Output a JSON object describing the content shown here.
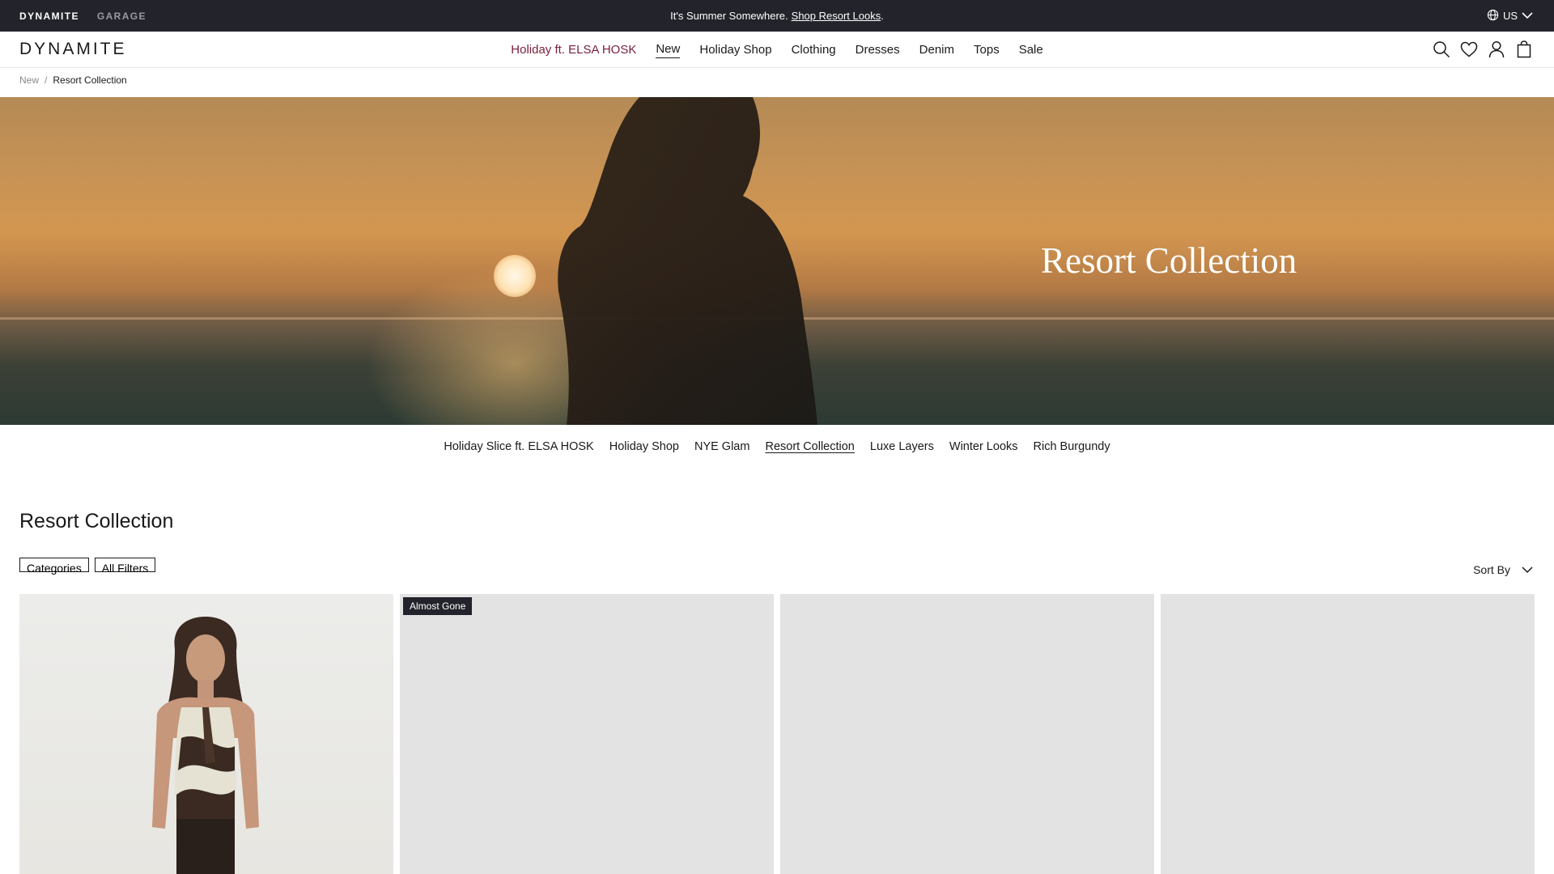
{
  "topbar": {
    "brands": [
      "DYNAMITE",
      "GARAGE"
    ],
    "promo_text": "It's Summer Somewhere.",
    "promo_link": "Shop Resort Looks",
    "promo_end": ".",
    "region": "US"
  },
  "header": {
    "logo": "DYNAMITE",
    "nav": [
      "Holiday ft. ELSA HOSK",
      "New",
      "Holiday Shop",
      "Clothing",
      "Dresses",
      "Denim",
      "Tops",
      "Sale"
    ],
    "icons": [
      "search-icon",
      "heart-icon",
      "account-icon",
      "bag-icon"
    ]
  },
  "breadcrumb": {
    "parent": "New",
    "separator": "/",
    "current": "Resort Collection"
  },
  "hero": {
    "title": "Resort Collection"
  },
  "subnav": [
    "Holiday Slice ft. ELSA HOSK",
    "Holiday Shop",
    "NYE Glam",
    "Resort Collection",
    "Luxe Layers",
    "Winter Looks",
    "Rich Burgundy"
  ],
  "listing": {
    "title": "Resort Collection",
    "filters": [
      "Categories",
      "All Filters"
    ],
    "sort_label": "Sort By",
    "products": [
      {
        "badge": ""
      },
      {
        "badge": "Almost Gone"
      },
      {
        "badge": ""
      },
      {
        "badge": ""
      }
    ]
  },
  "colors": {
    "topbar_bg": "#23232b",
    "feature_nav": "#7a1f3a",
    "placeholder": "#e3e3e3"
  }
}
